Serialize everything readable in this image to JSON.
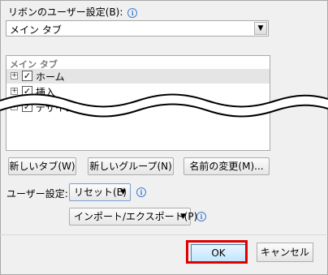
{
  "ribbon_section": {
    "label": "リボンのユーザー設定(B):",
    "info_icon": "info-icon",
    "selected_tab_type": "メイン タブ"
  },
  "tree": {
    "header": "メイン タブ",
    "items": [
      {
        "label": "ホーム",
        "checked": true,
        "expander": "⊞"
      },
      {
        "label": "挿入",
        "checked": true,
        "expander": "⊞"
      },
      {
        "label": "デザイン",
        "checked": true,
        "expander": "⊞"
      }
    ]
  },
  "buttons": {
    "new_tab": "新しいタブ(W)",
    "new_group": "新しいグループ(N)",
    "rename": "名前の変更(M)..."
  },
  "user_settings": {
    "label": "ユーザー設定:",
    "reset": "リセット(E)",
    "import_export": "インポート/エクスポート(P)"
  },
  "footer": {
    "ok": "OK",
    "cancel": "キャンセル"
  },
  "colors": {
    "highlight": "#e00000",
    "accent": "#3f7cd1"
  }
}
